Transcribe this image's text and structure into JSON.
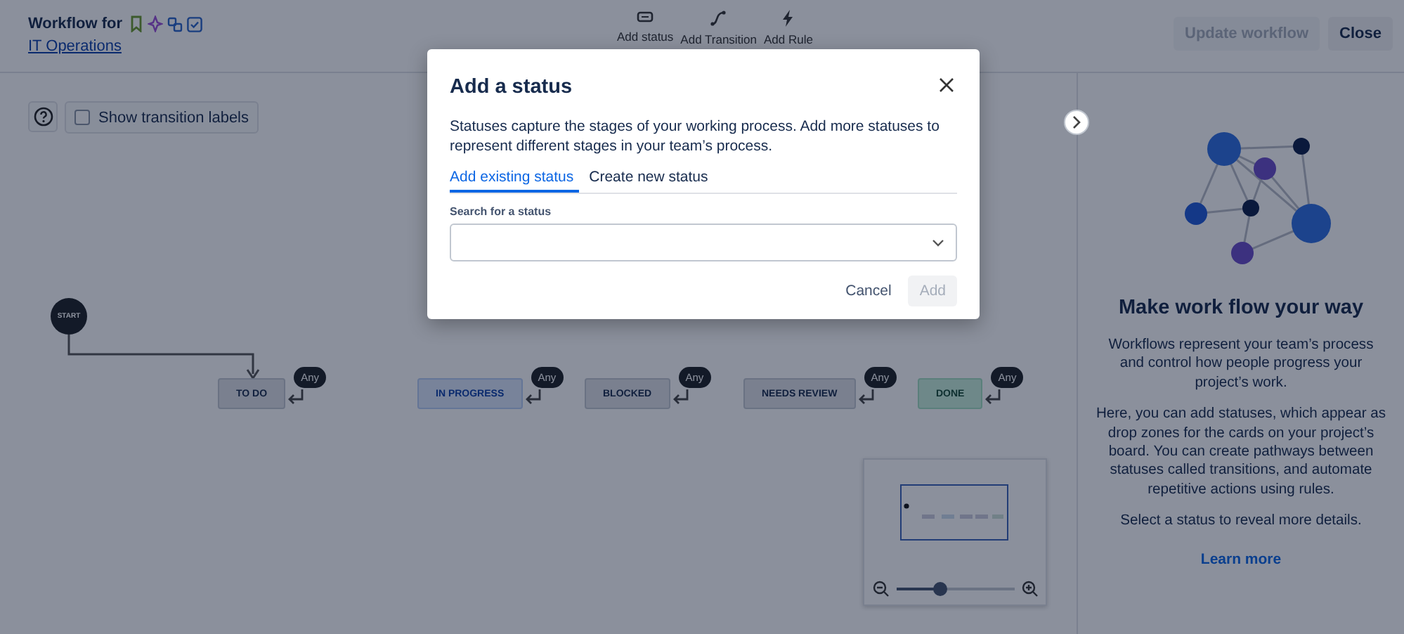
{
  "header": {
    "title": "Workflow for",
    "project_link": "IT Operations",
    "actions": [
      {
        "label": "Update workflow",
        "disabled": true
      },
      {
        "label": "Close",
        "disabled": false
      }
    ]
  },
  "toolbar": [
    {
      "kind": "status",
      "label": "Add status"
    },
    {
      "kind": "transition",
      "label": "Add Transition"
    },
    {
      "kind": "rule",
      "label": "Add Rule"
    }
  ],
  "canvas": {
    "transition_labels": {
      "label": "Show transition labels",
      "checked": false
    },
    "start": "START",
    "statuses": [
      {
        "name": "TO DO",
        "kind": "todo",
        "transition": "Any"
      },
      {
        "name": "IN PROGRESS",
        "kind": "progress",
        "transition": "Any"
      },
      {
        "name": "BLOCKED",
        "kind": "todo",
        "transition": "Any"
      },
      {
        "name": "NEEDS REVIEW",
        "kind": "todo",
        "transition": "Any"
      },
      {
        "name": "DONE",
        "kind": "done",
        "transition": "Any"
      }
    ],
    "zoom": {
      "level": 0.38
    }
  },
  "panel": {
    "heading": "Make work flow your way",
    "paragraphs": [
      "Workflows represent your team’s process and control how people progress your project’s work.",
      "Here, you can add statuses, which appear as drop zones for the cards on your project’s board. You can create pathways between statuses called transitions, and automate repetitive actions using rules.",
      "Select a status to reveal more details."
    ],
    "link": "Learn more"
  },
  "dialog": {
    "title": "Add a status",
    "description": "Statuses capture the stages of your working process. Add more statuses to represent different stages in your team’s process.",
    "tabs": [
      {
        "label": "Add existing status",
        "selected": true
      },
      {
        "label": "Create new status",
        "selected": false
      }
    ],
    "field_label": "Search for a status",
    "buttons": [
      {
        "label": "Cancel",
        "kind": "subtle",
        "disabled": false
      },
      {
        "label": "Add",
        "kind": "primary",
        "disabled": true
      }
    ]
  }
}
